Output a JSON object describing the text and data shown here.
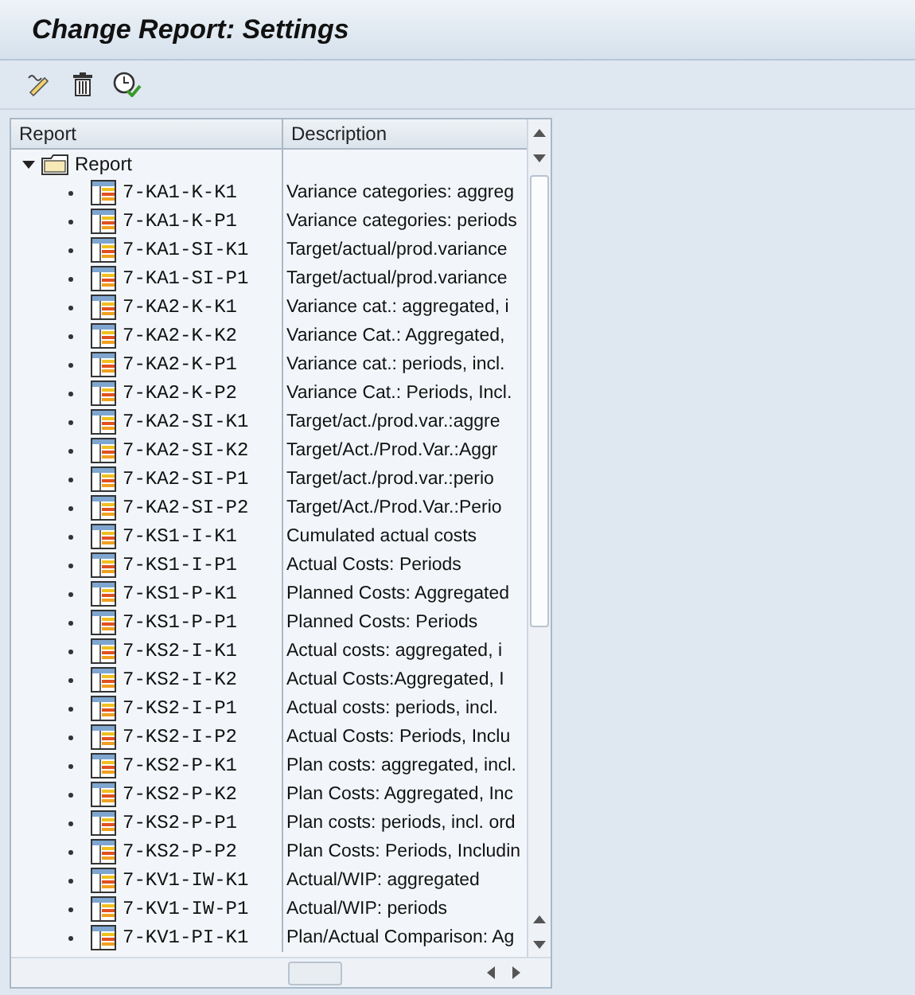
{
  "window": {
    "title": "Change Report: Settings"
  },
  "table": {
    "columns": [
      "Report",
      "Description"
    ],
    "root": {
      "label": "Report",
      "expanded": true,
      "children": [
        {
          "name": "7-KA1-K-K1",
          "description": "Variance categories: aggreg"
        },
        {
          "name": "7-KA1-K-P1",
          "description": "Variance categories: periods"
        },
        {
          "name": "7-KA1-SI-K1",
          "description": "Target/actual/prod.variance"
        },
        {
          "name": "7-KA1-SI-P1",
          "description": "Target/actual/prod.variance"
        },
        {
          "name": "7-KA2-K-K1",
          "description": "Variance cat.: aggregated, i"
        },
        {
          "name": "7-KA2-K-K2",
          "description": "Variance Cat.: Aggregated,"
        },
        {
          "name": "7-KA2-K-P1",
          "description": "Variance cat.: periods, incl."
        },
        {
          "name": "7-KA2-K-P2",
          "description": "Variance Cat.: Periods, Incl."
        },
        {
          "name": "7-KA2-SI-K1",
          "description": "Target/act./prod.var.:aggre"
        },
        {
          "name": "7-KA2-SI-K2",
          "description": "Target/Act./Prod.Var.:Aggr"
        },
        {
          "name": "7-KA2-SI-P1",
          "description": "Target/act./prod.var.:perio"
        },
        {
          "name": "7-KA2-SI-P2",
          "description": "Target/Act./Prod.Var.:Perio"
        },
        {
          "name": "7-KS1-I-K1",
          "description": "Cumulated actual costs"
        },
        {
          "name": "7-KS1-I-P1",
          "description": "Actual Costs: Periods"
        },
        {
          "name": "7-KS1-P-K1",
          "description": "Planned Costs: Aggregated"
        },
        {
          "name": "7-KS1-P-P1",
          "description": "Planned Costs: Periods"
        },
        {
          "name": "7-KS2-I-K1",
          "description": "Actual costs: aggregated, i"
        },
        {
          "name": "7-KS2-I-K2",
          "description": "Actual Costs:Aggregated, I"
        },
        {
          "name": "7-KS2-I-P1",
          "description": "Actual costs: periods, incl."
        },
        {
          "name": "7-KS2-I-P2",
          "description": "Actual Costs: Periods, Inclu"
        },
        {
          "name": "7-KS2-P-K1",
          "description": "Plan costs: aggregated, incl."
        },
        {
          "name": "7-KS2-P-K2",
          "description": "Plan Costs: Aggregated, Inc"
        },
        {
          "name": "7-KS2-P-P1",
          "description": "Plan costs: periods, incl. ord"
        },
        {
          "name": "7-KS2-P-P2",
          "description": "Plan Costs: Periods, Includin"
        },
        {
          "name": "7-KV1-IW-K1",
          "description": "Actual/WIP: aggregated"
        },
        {
          "name": "7-KV1-IW-P1",
          "description": "Actual/WIP: periods"
        },
        {
          "name": "7-KV1-PI-K1",
          "description": "Plan/Actual Comparison: Ag"
        }
      ]
    }
  }
}
